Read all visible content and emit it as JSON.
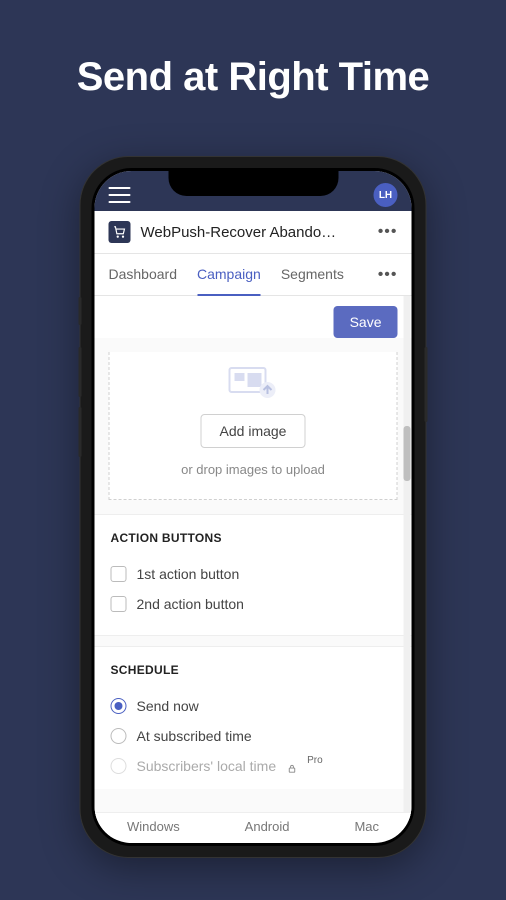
{
  "headline": "Send at Right Time",
  "topbar": {
    "avatar_initials": "LH"
  },
  "app": {
    "title": "WebPush-Recover Abando…"
  },
  "tabs": {
    "items": [
      "Dashboard",
      "Campaign",
      "Segments"
    ],
    "active_index": 1
  },
  "actions": {
    "save_label": "Save"
  },
  "image_upload": {
    "button_label": "Add image",
    "drop_hint": "or drop images to upload"
  },
  "action_buttons_section": {
    "title": "ACTION BUTTONS",
    "options": [
      {
        "label": "1st action button",
        "checked": false
      },
      {
        "label": "2nd action button",
        "checked": false
      }
    ]
  },
  "schedule_section": {
    "title": "SCHEDULE",
    "options": [
      {
        "label": "Send now",
        "selected": true,
        "locked": false
      },
      {
        "label": "At subscribed time",
        "selected": false,
        "locked": false
      },
      {
        "label": "Subscribers' local time",
        "selected": false,
        "locked": true,
        "badge": "Pro"
      }
    ]
  },
  "platform_tabs": [
    "Windows",
    "Android",
    "Mac"
  ]
}
